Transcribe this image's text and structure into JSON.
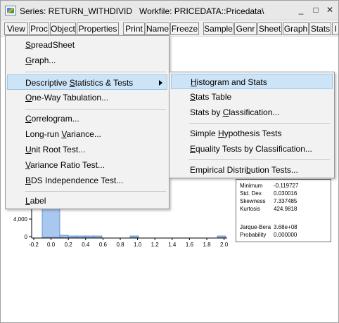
{
  "window": {
    "title": "Series: RETURN_WITHDIVID   Workfile: PRICEDATA::Pricedata\\",
    "controls": {
      "minimize": "_",
      "restore": "□",
      "close": "✕"
    }
  },
  "toolbar": {
    "buttons": [
      "View",
      "Proc",
      "Object",
      "Properties",
      "Print",
      "Name",
      "Freeze",
      "Sample",
      "Genr",
      "Sheet",
      "Graph",
      "Stats",
      "I"
    ]
  },
  "view_menu": {
    "items": [
      {
        "pre": "",
        "ul": "S",
        "post": "preadSheet"
      },
      {
        "pre": "",
        "ul": "G",
        "post": "raph..."
      },
      {
        "pre": "Descriptive ",
        "ul": "S",
        "post": "tatistics & Tests"
      },
      {
        "pre": "",
        "ul": "O",
        "post": "ne-Way Tabulation..."
      },
      {
        "pre": "",
        "ul": "C",
        "post": "orrelogram..."
      },
      {
        "pre": "Long-run ",
        "ul": "V",
        "post": "ariance..."
      },
      {
        "pre": "",
        "ul": "U",
        "post": "nit Root Test..."
      },
      {
        "pre": "",
        "ul": "V",
        "post": "ariance Ratio Test..."
      },
      {
        "pre": "",
        "ul": "B",
        "post": "DS Independence Test..."
      },
      {
        "pre": "",
        "ul": "L",
        "post": "abel"
      }
    ]
  },
  "stats_submenu": {
    "items": [
      {
        "pre": "",
        "ul": "H",
        "post": "istogram and Stats"
      },
      {
        "pre": "",
        "ul": "S",
        "post": "tats Table"
      },
      {
        "pre": "Stats by ",
        "ul": "C",
        "post": "lassification..."
      },
      {
        "pre": "Simple ",
        "ul": "H",
        "post": "ypothesis Tests"
      },
      {
        "pre": "",
        "ul": "E",
        "post": "quality Tests by Classification..."
      },
      {
        "pre": "Empirical Distri",
        "ul": "b",
        "post": "ution Tests..."
      }
    ]
  },
  "histogram": {
    "y_tick_labels": [
      "4,000",
      "0"
    ],
    "x_tick_labels": [
      "-0.2",
      "0.0",
      "0.2",
      "0.4",
      "0.6",
      "0.8",
      "1.0",
      "1.2",
      "1.4",
      "1.6",
      "1.8",
      "2.0"
    ],
    "bar_color": "#a8c8f0"
  },
  "stats": {
    "rows": [
      {
        "label": "Minimum",
        "value": "-0.119727"
      },
      {
        "label": "Std. Dev.",
        "value": "0.030016"
      },
      {
        "label": "Skewness",
        "value": "7.337485"
      },
      {
        "label": "Kurtosis",
        "value": "424.9818"
      },
      {
        "label": "Jarque-Bera",
        "value": "3.68e+08"
      },
      {
        "label": "Probability",
        "value": "0.000000"
      }
    ]
  }
}
